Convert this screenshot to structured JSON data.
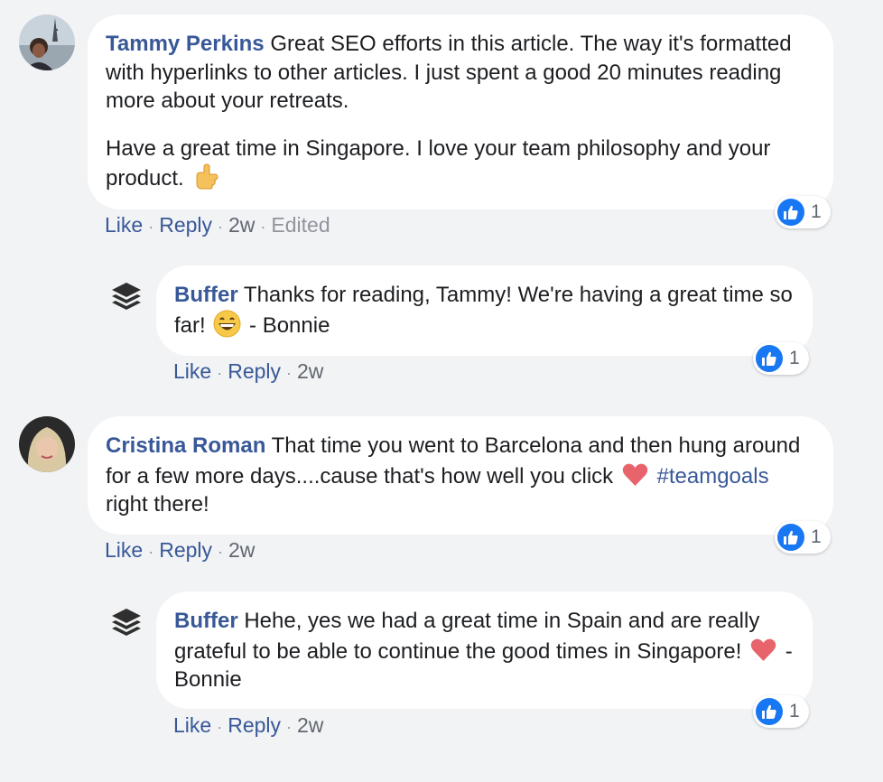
{
  "colors": {
    "author": "#385898",
    "link": "#385898",
    "bubble": "#ffffff",
    "background": "#f2f3f5",
    "like_badge": "#1877f2",
    "muted": "#606770"
  },
  "comments": [
    {
      "author": "Tammy Perkins",
      "paragraphs": [
        "Great SEO efforts in this article. The way it's formatted with hyperlinks to other articles. I just spent a good 20 minutes reading more about your retreats.",
        "Have a great time in Singapore. I love your team philosophy and your product."
      ],
      "emoji": "pointing-hand-emoji",
      "reaction_count": "1",
      "actions": {
        "like": "Like",
        "reply": "Reply",
        "time": "2w",
        "edited": "Edited"
      },
      "reply": {
        "author": "Buffer",
        "text_before": "Thanks for reading, Tammy! We're having a great time so far!",
        "emoji": "grinning-face-emoji",
        "text_after": "- Bonnie",
        "reaction_count": "1",
        "actions": {
          "like": "Like",
          "reply": "Reply",
          "time": "2w"
        }
      }
    },
    {
      "author": "Cristina Roman",
      "text_before": "That time you went to Barcelona and then hung around for a few more days....cause that's how well you click",
      "emoji": "heart-emoji",
      "hashtag": "#teamgoals",
      "text_after": "right there!",
      "reaction_count": "1",
      "actions": {
        "like": "Like",
        "reply": "Reply",
        "time": "2w"
      },
      "reply": {
        "author": "Buffer",
        "text_before": "Hehe, yes we had a great time in Spain and are really grateful to be able to continue the good times in Singapore!",
        "emoji": "heart-emoji",
        "text_after": "- Bonnie",
        "reaction_count": "1",
        "actions": {
          "like": "Like",
          "reply": "Reply",
          "time": "2w"
        }
      }
    }
  ]
}
